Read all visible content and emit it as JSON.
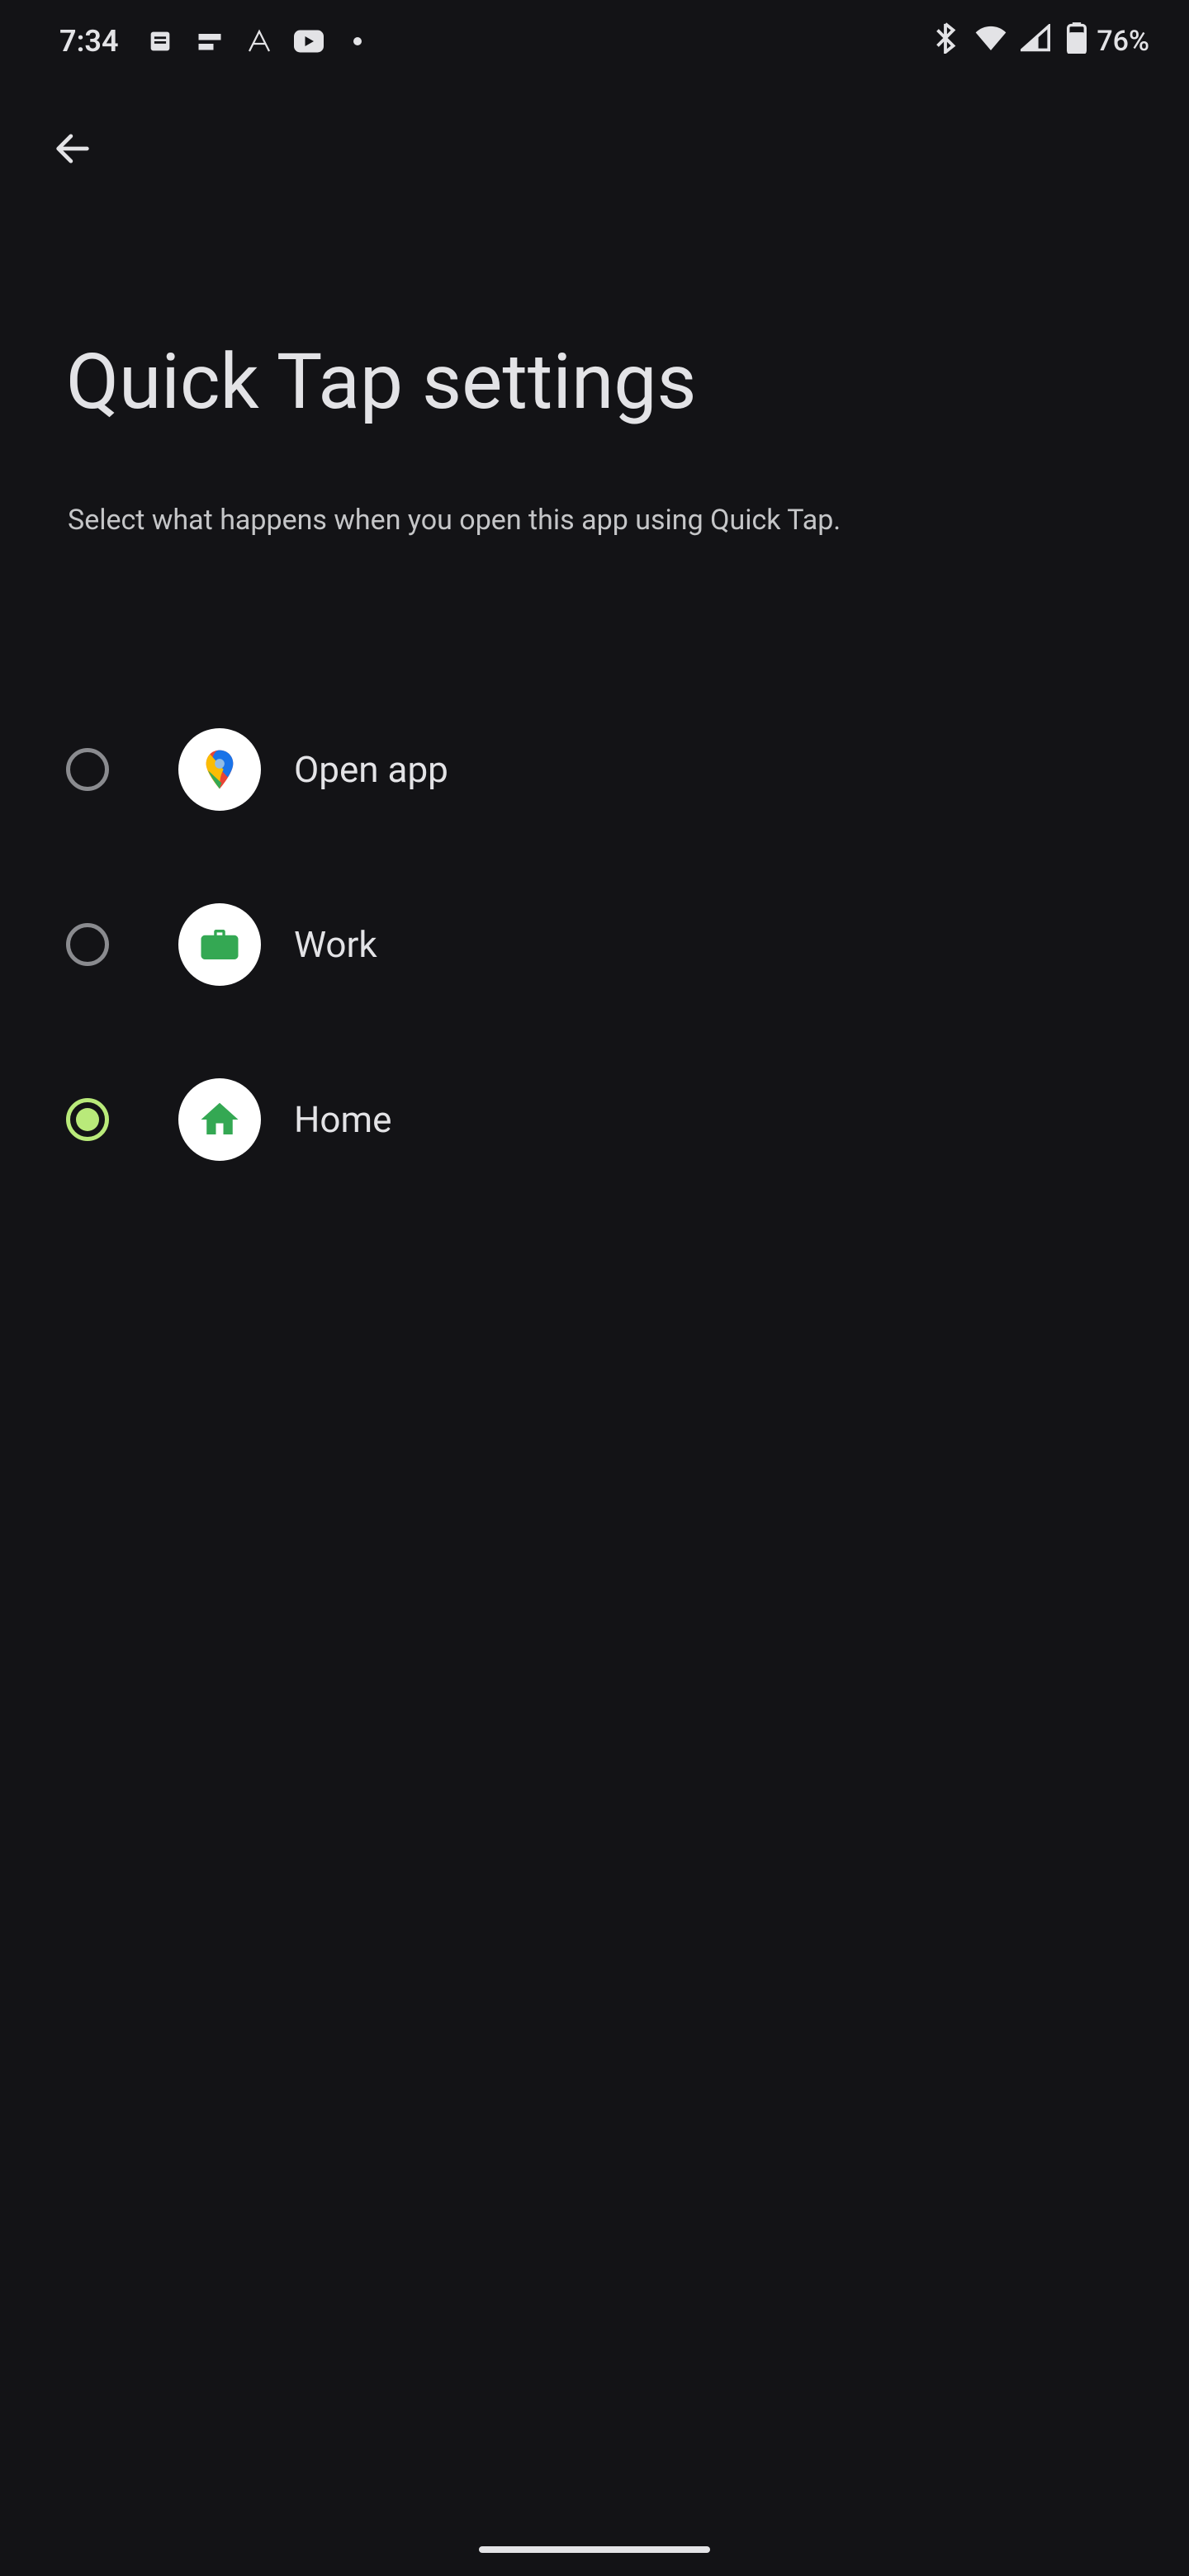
{
  "status": {
    "time": "7:34",
    "battery": "76%"
  },
  "header": {
    "title": "Quick Tap settings",
    "subtitle": "Select what happens when you open this app using Quick Tap."
  },
  "options": [
    {
      "label": "Open app",
      "selected": false,
      "icon": "maps"
    },
    {
      "label": "Work",
      "selected": false,
      "icon": "briefcase"
    },
    {
      "label": "Home",
      "selected": true,
      "icon": "home"
    }
  ]
}
